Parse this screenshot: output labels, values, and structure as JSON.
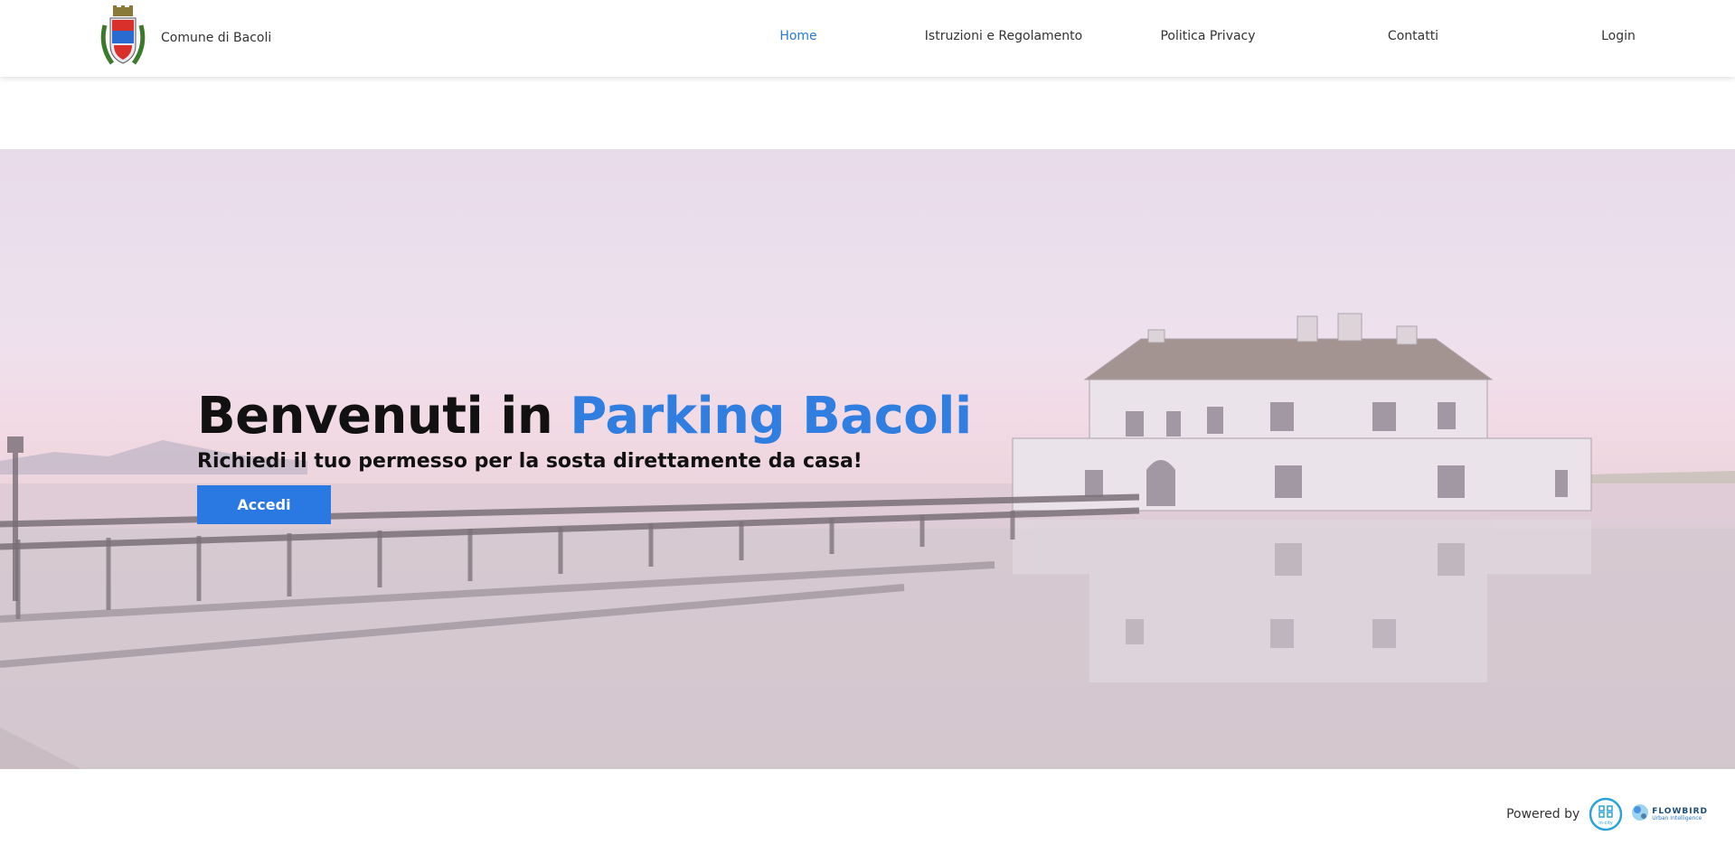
{
  "header": {
    "brand_name": "Comune di Bacoli",
    "crest_icon": "municipal-crest-icon",
    "nav": [
      {
        "label": "Home",
        "active": true
      },
      {
        "label": "Istruzioni e Regolamento",
        "active": false
      },
      {
        "label": "Politica Privacy",
        "active": false
      },
      {
        "label": "Contatti",
        "active": false
      },
      {
        "label": "Login",
        "active": false
      }
    ]
  },
  "hero": {
    "title_prefix": "Benvenuti in ",
    "title_accent": "Parking Bacoli",
    "subtitle": "Richiedi il tuo permesso per la sosta direttamente da casa!",
    "cta_label": "Accedi"
  },
  "footer": {
    "powered_by": "Powered by",
    "partner1_label": "in-city",
    "partner2_name": "FLOWBIRD",
    "partner2_tagline": "Urban Intelligence"
  },
  "colors": {
    "accent": "#2a79e2",
    "nav_active": "#2a79d9",
    "title_accent": "#2f7ee0"
  }
}
